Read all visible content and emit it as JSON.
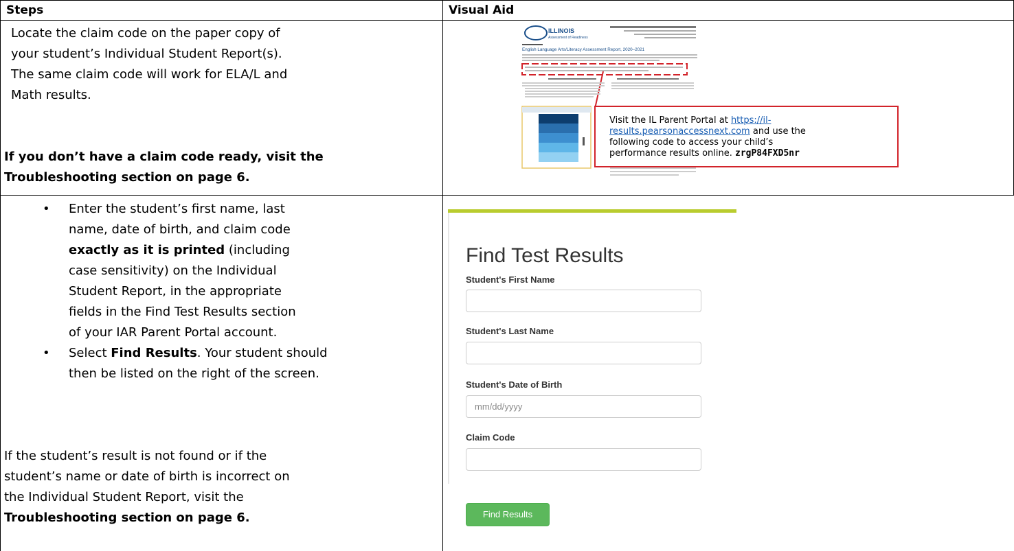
{
  "table": {
    "header_steps": "Steps",
    "header_visual": "Visual Aid"
  },
  "row1": {
    "lines": [
      "Locate the claim code on the paper copy of",
      "your student’s Individual Student Report(s).",
      "The same claim code will work for ELA/L and",
      "Math results."
    ],
    "bold_lines": [
      "If you don’t have a claim code ready, visit the",
      "Troubleshooting section on page 6."
    ]
  },
  "report": {
    "logo_text": "ILLINOIS",
    "logo_sub": "Assessment of Readiness",
    "title": "English Language Arts/Literacy Assessment Report, 2020–2021",
    "callout_line1_prefix": "Visit the IL Parent Portal at ",
    "callout_link1": "https://il-",
    "callout_link2": "results.pearsonaccessnext.com",
    "callout_line2_suffix": " and use the",
    "callout_line3": "following code to access your child’s",
    "callout_line4_prefix": "performance results online.  ",
    "callout_code": "zrgP84FXD5nr",
    "colors": {
      "red": "#d2232a",
      "blue_dark": "#0d3d6e",
      "blue_light": "#5fb6e8"
    }
  },
  "row2": {
    "bullet1_lines": [
      "Enter the student’s first name, last",
      "name, date of birth, and claim code"
    ],
    "bullet1_bold": "exactly as it is printed",
    "bullet1_after_bold": " (including",
    "bullet1_rest": [
      "case sensitivity) on the Individual",
      "Student Report, in the appropriate",
      "fields in the Find Test Results section",
      "of your IAR Parent Portal account."
    ],
    "bullet2_prefix": "Select ",
    "bullet2_bold": "Find Results",
    "bullet2_suffix": ". Your student should",
    "bullet2_line2": "then be listed on the right of the screen.",
    "note_lines": [
      "If the student’s result is not found or if the",
      "student’s name or date of birth is incorrect on",
      "the Individual Student Report, visit the"
    ],
    "note_bold": "Troubleshooting section on page 6."
  },
  "form": {
    "title": "Find Test Results",
    "first_name_label": "Student's First Name",
    "last_name_label": "Student's Last Name",
    "dob_label": "Student's Date of Birth",
    "dob_placeholder": "mm/dd/yyyy",
    "claim_label": "Claim Code",
    "button": "Find Results",
    "accent": "#b9cc2e",
    "button_color": "#5cb85c"
  }
}
